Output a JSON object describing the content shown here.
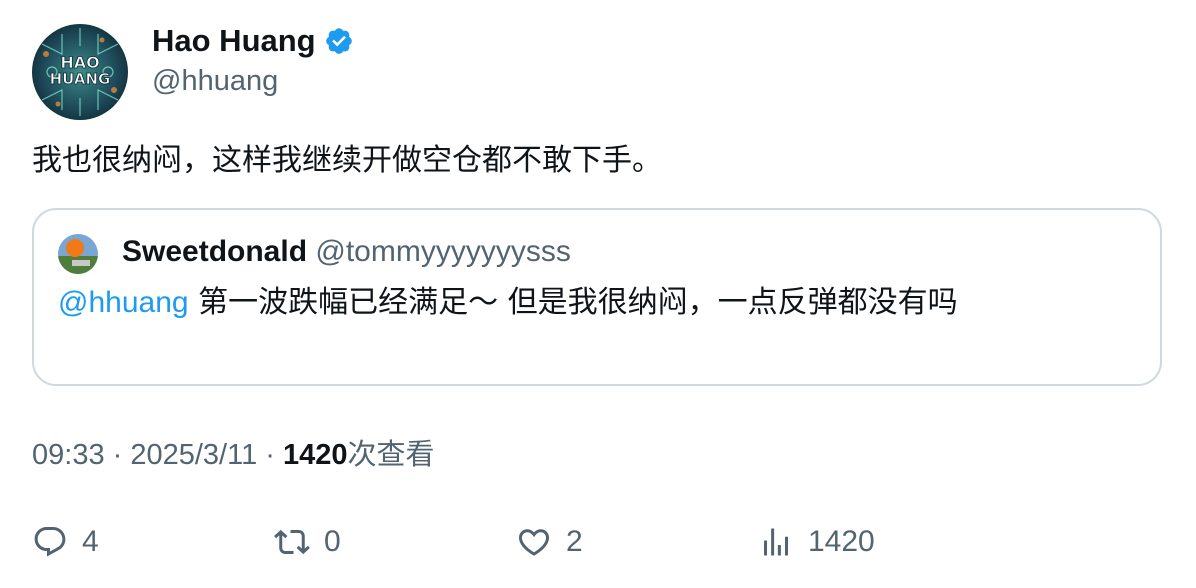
{
  "author": {
    "display_name": "Hao Huang",
    "handle": "@hhuang",
    "avatar_text_line1": "HAO",
    "avatar_text_line2": "HUANG",
    "verified_color": "#1d9bf0"
  },
  "tweet": {
    "text": "我也很纳闷，这样我继续开做空仓都不敢下手。"
  },
  "quote": {
    "display_name": "Sweetdonald",
    "handle": "@tommyyyyyyysss",
    "mention": "@hhuang",
    "text": " 第一波跌幅已经满足～ 但是我很纳闷，一点反弹都没有吗"
  },
  "meta": {
    "time": "09:33",
    "separator1": " · ",
    "date": "2025/3/11",
    "separator2": " · ",
    "views_count": "1420",
    "views_label": "次查看"
  },
  "actions": {
    "replies": "4",
    "reposts": "0",
    "likes": "2",
    "views": "1420"
  },
  "colors": {
    "text_primary": "#0f1419",
    "text_secondary": "#536471",
    "accent": "#1d9bf0",
    "border": "#cfd9de"
  }
}
